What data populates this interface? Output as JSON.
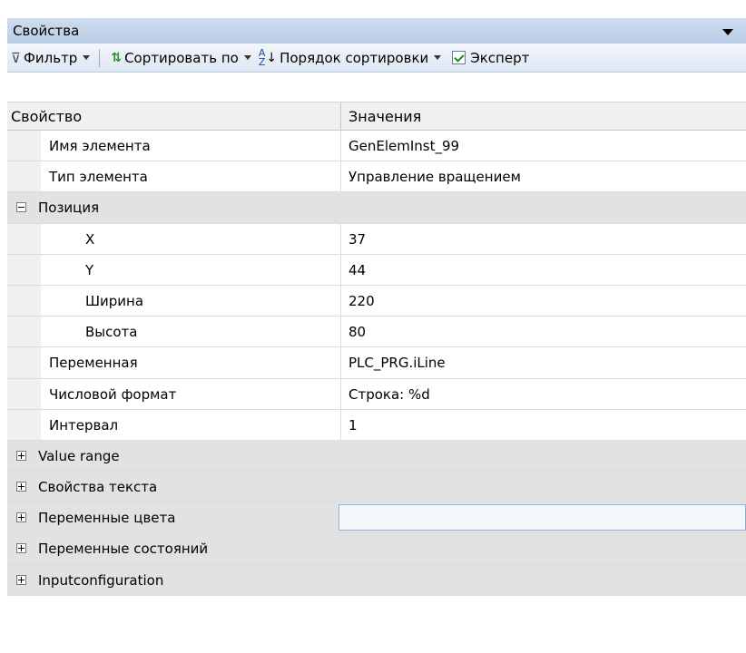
{
  "panel": {
    "title": "Свойства"
  },
  "toolbar": {
    "filter_label": "Фильтр",
    "sort_by_label": "Сортировать по",
    "sort_order_label": "Порядок сортировки",
    "expert_label": "Эксперт",
    "expert_checked": true
  },
  "header": {
    "property": "Свойство",
    "values": "Значения"
  },
  "rows": {
    "element_name": {
      "label": "Имя элемента",
      "value": "GenElemInst_99"
    },
    "element_type": {
      "label": "Тип элемента",
      "value": "Управление вращением"
    },
    "position": {
      "label": "Позиция"
    },
    "x": {
      "label": "X",
      "value": "37"
    },
    "y": {
      "label": "Y",
      "value": "44"
    },
    "width": {
      "label": "Ширина",
      "value": "220"
    },
    "height": {
      "label": "Высота",
      "value": "80"
    },
    "variable": {
      "label": "Переменная",
      "value": "PLC_PRG.iLine"
    },
    "number_format": {
      "label": "Числовой формат",
      "value": "Строка: %d"
    },
    "interval": {
      "label": "Интервал",
      "value": "1"
    },
    "value_range": {
      "label": "Value range"
    },
    "text_properties": {
      "label": "Свойства текста"
    },
    "color_variables": {
      "label": "Переменные цвета"
    },
    "state_variables": {
      "label": "Переменные состояний"
    },
    "input_configuration": {
      "label": "Inputconfiguration"
    }
  }
}
